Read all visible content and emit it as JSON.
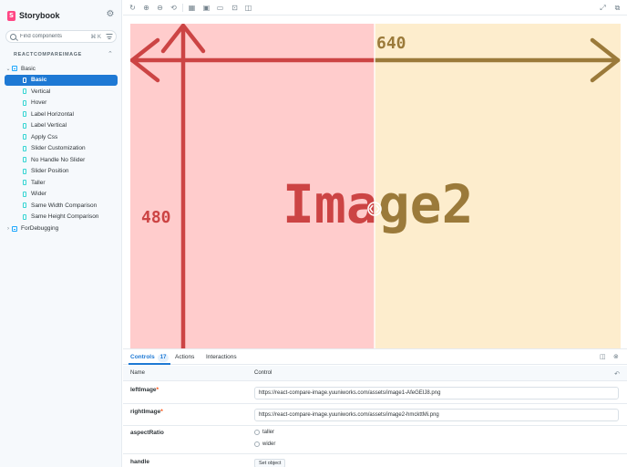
{
  "brand": {
    "name": "Storybook"
  },
  "search": {
    "placeholder": "Find components",
    "shortcut": "⌘ K"
  },
  "sidebar": {
    "section": "REACTCOMPAREIMAGE",
    "group_basic": "Basic",
    "stories": [
      "Basic",
      "Vertical",
      "Hover",
      "Label Horizontal",
      "Label Vertical",
      "Apply Css",
      "Slider Customization",
      "No Handle No Slider",
      "Slider Position",
      "Taller",
      "Wider",
      "Same Width Comparison",
      "Same Height Comparison"
    ],
    "selected_story": "Basic",
    "group_debug": "ForDebugging"
  },
  "preview": {
    "left_width_label": "640",
    "left_height_label": "480",
    "right_text": "Image2",
    "colors": {
      "left_bg": "#ffcccc",
      "right_bg": "#fdedcd",
      "left_fg": "#cc4444",
      "right_fg": "#9b7a3a"
    }
  },
  "panel": {
    "tabs": {
      "controls": "Controls",
      "controls_count": "17",
      "actions": "Actions",
      "interactions": "Interactions"
    },
    "headers": {
      "name": "Name",
      "control": "Control"
    },
    "rows": {
      "left_image": {
        "name": "leftImage",
        "required": "*",
        "value": "https://react-compare-image.yuuniworks.com/assets/image1-AfeGEIJ8.png"
      },
      "right_image": {
        "name": "rightImage",
        "required": "*",
        "value": "https://react-compare-image.yuuniworks.com/assets/image2-hmckttMi.png"
      },
      "aspect_ratio": {
        "name": "aspectRatio",
        "options": [
          "taller",
          "wider"
        ]
      },
      "handle": {
        "name": "handle",
        "button": "Set object"
      }
    }
  },
  "colors": {
    "accent": "#1e79d4",
    "brand": "#ff4785"
  }
}
